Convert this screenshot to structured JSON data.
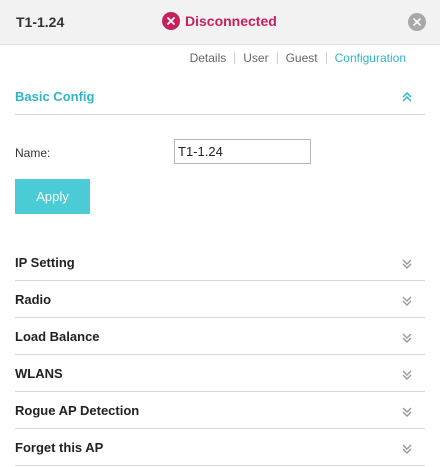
{
  "header": {
    "device_name": "T1-1.24",
    "status_text": "Disconnected",
    "status_color": "#c7205f",
    "close_icon": "close-circle-icon"
  },
  "tabs": [
    {
      "label": "Details",
      "active": false
    },
    {
      "label": "User",
      "active": false
    },
    {
      "label": "Guest",
      "active": false
    },
    {
      "label": "Configuration",
      "active": true
    }
  ],
  "basic_config": {
    "title": "Basic Config",
    "expanded": true,
    "name_label": "Name:",
    "name_value": "T1-1.24",
    "apply_label": "Apply"
  },
  "sections": [
    {
      "label": "IP Setting"
    },
    {
      "label": "Radio"
    },
    {
      "label": "Load Balance"
    },
    {
      "label": "WLANS"
    },
    {
      "label": "Rogue AP Detection"
    },
    {
      "label": "Forget this AP"
    }
  ],
  "colors": {
    "accent": "#2fb4cc",
    "button": "#4acbd6",
    "error": "#c7205f"
  }
}
